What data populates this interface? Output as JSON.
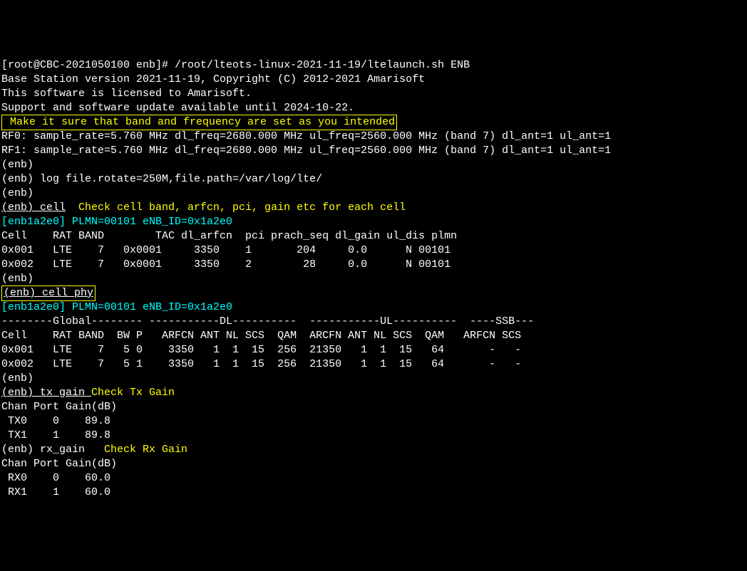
{
  "prompt": "[root@CBC-2021050100 enb]# /root/lteots-linux-2021-11-19/ltelaunch.sh ENB",
  "banner": {
    "l1": "Base Station version 2021-11-19, Copyright (C) 2012-2021 Amarisoft",
    "l2": "This software is licensed to Amarisoft.",
    "l3": "Support and software update available until 2024-10-22."
  },
  "anno1": " Make it sure that band and frequency are set as you intended",
  "rf0": "RF0: sample_rate=5.760 MHz dl_freq=2680.000 MHz ul_freq=2560.000 MHz (band 7) dl_ant=1 ul_ant=1",
  "rf1": "RF1: sample_rate=5.760 MHz dl_freq=2680.000 MHz ul_freq=2560.000 MHz (band 7) dl_ant=1 ul_ant=1",
  "enb_plain": "(enb)",
  "enb_log": "(enb) log file.rotate=250M,file.path=/var/log/lte/",
  "cmd_cell": "(enb) cell",
  "anno2": "  Check cell band, arfcn, pci, gain etc for each cell",
  "plmn_hdr1": "[enb1a2e0] PLMN=00101 eNB_ID=0x1a2e0",
  "table1": {
    "hdr": "Cell    RAT BAND        TAC dl_arfcn  pci prach_seq dl_gain ul_dis plmn",
    "r1": "0x001   LTE    7   0x0001     3350    1       204     0.0      N 00101",
    "r2": "0x002   LTE    7   0x0001     3350    2        28     0.0      N 00101"
  },
  "cmd_cellphy": "(enb) cell phy",
  "plmn_hdr2": "[enb1a2e0] PLMN=00101 eNB_ID=0x1a2e0",
  "table2": {
    "divider": "--------Global-------- -----------DL----------  -----------UL----------  ----SSB---",
    "hdr": "Cell    RAT BAND  BW P   ARFCN ANT NL SCS  QAM  ARCFN ANT NL SCS  QAM   ARFCN SCS",
    "r1": "0x001   LTE    7   5 0    3350   1  1  15  256  21350   1  1  15   64       -   -",
    "r2": "0x002   LTE    7   5 1    3350   1  1  15  256  21350   1  1  15   64       -   -"
  },
  "cmd_tx": "(enb) tx_gain ",
  "anno3": "Check Tx Gain",
  "tx": {
    "hdr": "Chan Port Gain(dB)",
    "r1": " TX0    0    89.8",
    "r2": " TX1    1    89.8"
  },
  "cmd_rx": "(enb) rx_gain ",
  "anno4": "  Check Rx Gain",
  "rx": {
    "hdr": "Chan Port Gain(dB)",
    "r1": " RX0    0    60.0",
    "r2": " RX1    1    60.0"
  }
}
